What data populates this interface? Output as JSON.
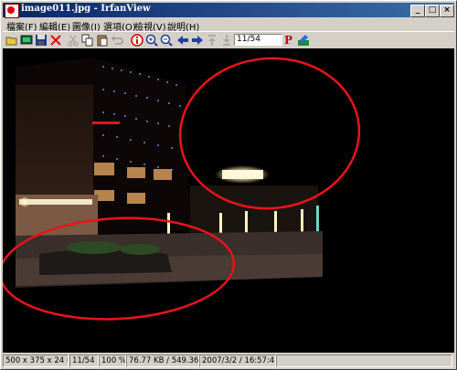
{
  "window": {
    "title": "image011.jpg - IrfanView"
  },
  "title_buttons": {
    "minimize": "_",
    "maximize": "□",
    "close": "×"
  },
  "menu": [
    {
      "label": "檔案(F)"
    },
    {
      "label": "編輯(E)"
    },
    {
      "label": "圖像(I)"
    },
    {
      "label": "選項(O)"
    },
    {
      "label": "檢視(V)"
    },
    {
      "label": "說明(H)"
    }
  ],
  "toolbar": {
    "page_indicator": "11/54",
    "icons": [
      "open-icon",
      "slideshow-icon",
      "save-icon",
      "delete-icon",
      "cut-icon",
      "copy-icon",
      "paste-icon",
      "undo-icon",
      "info-icon",
      "zoom-in-icon",
      "zoom-out-icon",
      "previous-icon",
      "next-icon",
      "first-page-icon",
      "last-page-icon",
      "print-icon",
      "paint-icon"
    ],
    "print_glyph": "P"
  },
  "status": {
    "dimensions": "500 x 375 x 24 BPP",
    "index": "11/54",
    "zoom": "100 %",
    "file_size": "76.77 KB / 549.36 KB",
    "datetime": "2007/3/2 / 16:57:42"
  },
  "colors": {
    "annotation": "#e8141c",
    "titlebar": "#0a246a"
  }
}
